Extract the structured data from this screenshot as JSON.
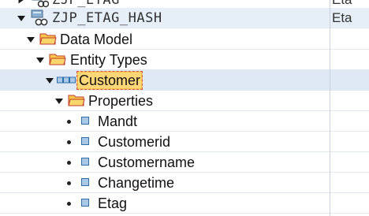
{
  "tree": {
    "services": [
      {
        "label": "ZJP_ETAG",
        "col2": "Eta"
      },
      {
        "label": "ZJP_ETAG_HASH",
        "col2": "Eta"
      }
    ],
    "data_model": "Data Model",
    "entity_types": "Entity Types",
    "entity": "Customer",
    "properties": "Properties",
    "property_items": [
      "Mandt",
      "Customerid",
      "Customername",
      "Changetime",
      "Etag"
    ]
  }
}
